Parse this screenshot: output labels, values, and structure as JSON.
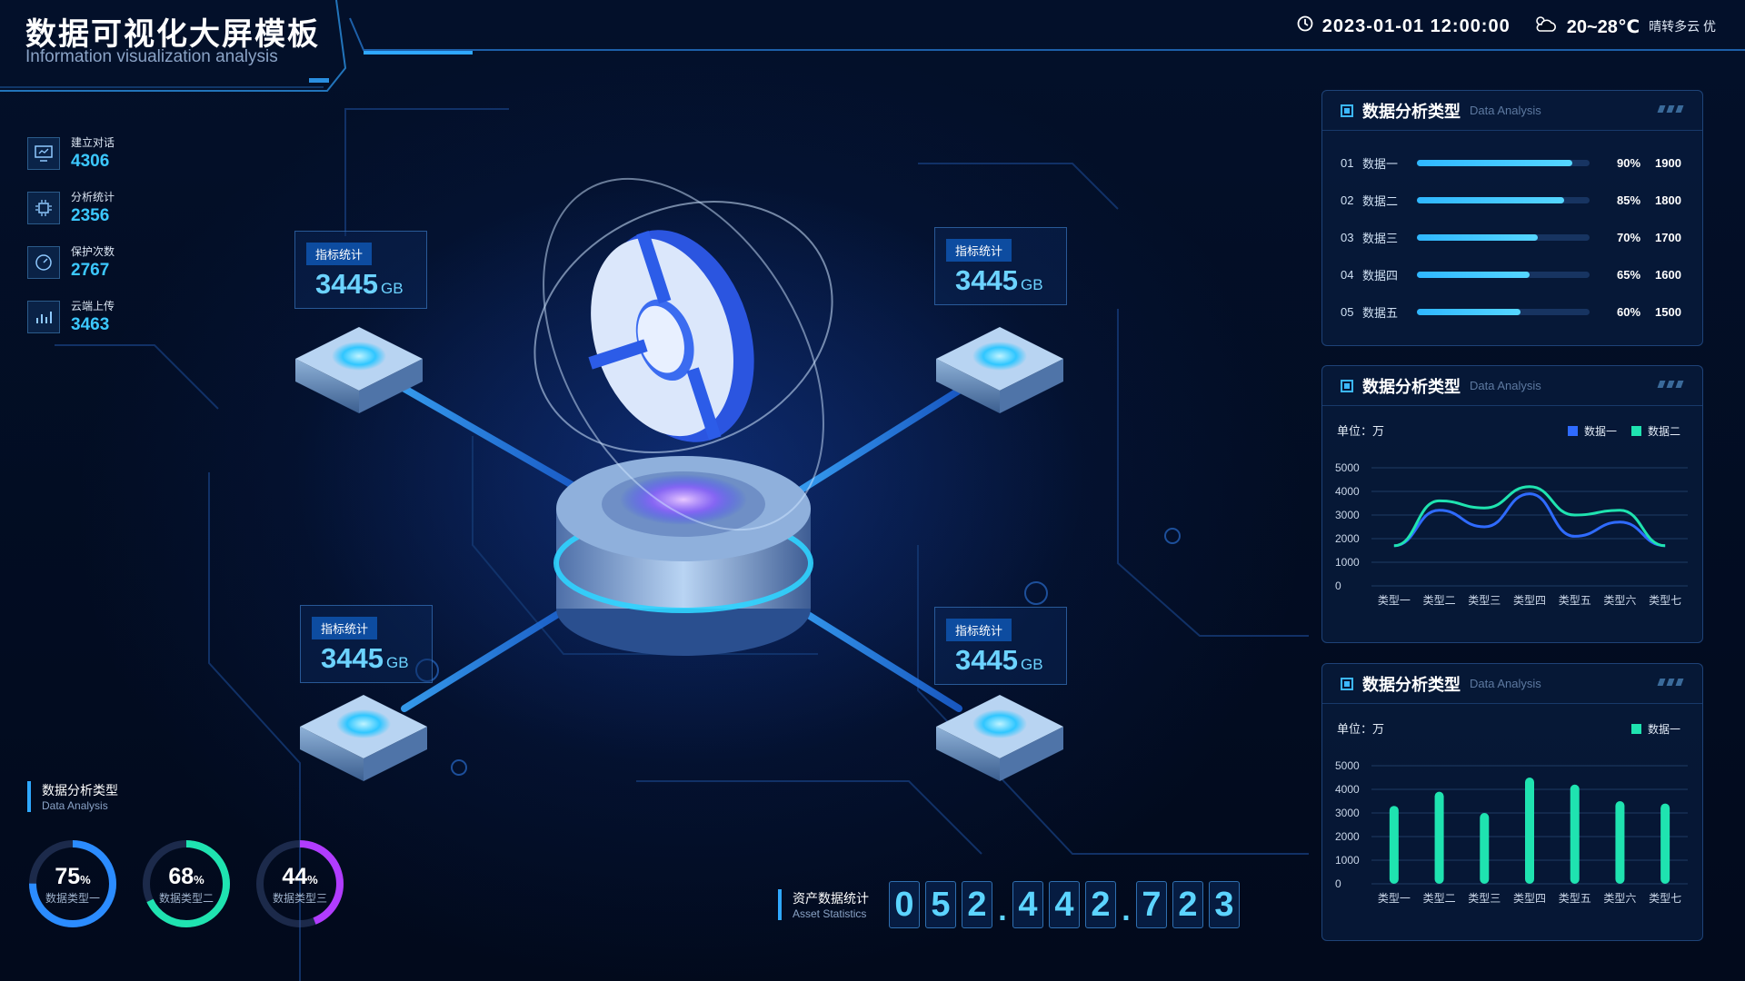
{
  "header": {
    "title": "数据可视化大屏模板",
    "subtitle": "Information visualization analysis",
    "datetime": "2023-01-01  12:00:00",
    "temperature": "20~28℃",
    "weather": "晴转多云  优"
  },
  "stats": [
    {
      "label": "建立对话",
      "value": "4306",
      "icon": "monitor-icon"
    },
    {
      "label": "分析统计",
      "value": "2356",
      "icon": "chip-icon"
    },
    {
      "label": "保护次数",
      "value": "2767",
      "icon": "gauge-icon"
    },
    {
      "label": "云端上传",
      "value": "3463",
      "icon": "chart-bars-icon"
    }
  ],
  "cards": [
    {
      "tag": "指标统计",
      "value": "3445",
      "unit": "GB"
    },
    {
      "tag": "指标统计",
      "value": "3445",
      "unit": "GB"
    },
    {
      "tag": "指标统计",
      "value": "3445",
      "unit": "GB"
    },
    {
      "tag": "指标统计",
      "value": "3445",
      "unit": "GB"
    }
  ],
  "ranking_panel": {
    "title": "数据分析类型",
    "subtitle": "Data Analysis",
    "rows": [
      {
        "idx": "01",
        "name": "数据一",
        "percent": 90,
        "percent_label": "90%",
        "count": "1900"
      },
      {
        "idx": "02",
        "name": "数据二",
        "percent": 85,
        "percent_label": "85%",
        "count": "1800"
      },
      {
        "idx": "03",
        "name": "数据三",
        "percent": 70,
        "percent_label": "70%",
        "count": "1700"
      },
      {
        "idx": "04",
        "name": "数据四",
        "percent": 65,
        "percent_label": "65%",
        "count": "1600"
      },
      {
        "idx": "05",
        "name": "数据五",
        "percent": 60,
        "percent_label": "60%",
        "count": "1500"
      }
    ]
  },
  "line_panel": {
    "title": "数据分析类型",
    "subtitle": "Data Analysis",
    "unit": "单位：万"
  },
  "bar_panel": {
    "title": "数据分析类型",
    "subtitle": "Data Analysis",
    "unit": "单位：万"
  },
  "chart_data": [
    {
      "type": "line",
      "categories": [
        "类型一",
        "类型二",
        "类型三",
        "类型四",
        "类型五",
        "类型六",
        "类型七"
      ],
      "ylim": [
        0,
        5000
      ],
      "yticks": [
        "5000",
        "4000",
        "3000",
        "2000",
        "1000",
        "0"
      ],
      "series": [
        {
          "name": "数据一",
          "color": "#2f6bff",
          "values": [
            1700,
            3200,
            2500,
            3900,
            2100,
            2700,
            1700
          ]
        },
        {
          "name": "数据二",
          "color": "#1fe3b0",
          "values": [
            1700,
            3600,
            3300,
            4200,
            3000,
            3200,
            1700
          ]
        }
      ],
      "legend": "top-right"
    },
    {
      "type": "bar",
      "categories": [
        "类型一",
        "类型二",
        "类型三",
        "类型四",
        "类型五",
        "类型六",
        "类型七"
      ],
      "ylim": [
        0,
        5000
      ],
      "yticks": [
        "5000",
        "4000",
        "3000",
        "2000",
        "1000",
        "0"
      ],
      "series": [
        {
          "name": "数据一",
          "color": "#1fe3b0",
          "values": [
            3300,
            3900,
            3000,
            4500,
            4200,
            3500,
            3400
          ]
        }
      ],
      "legend": "top-right"
    }
  ],
  "rings_section": {
    "title": "数据分析类型",
    "subtitle": "Data Analysis"
  },
  "rings": [
    {
      "percent": 75,
      "num": "75",
      "suffix": "%",
      "label": "数据类型一",
      "color": "#2b8cff"
    },
    {
      "percent": 68,
      "num": "68",
      "suffix": "%",
      "label": "数据类型二",
      "color": "#1fe3b0"
    },
    {
      "percent": 44,
      "num": "44",
      "suffix": "%",
      "label": "数据类型三",
      "color": "#b13cff"
    }
  ],
  "asset": {
    "title": "资产数据统计",
    "subtitle": "Asset Statistics",
    "digits": [
      "0",
      "5",
      "2",
      ".",
      "4",
      "4",
      "2",
      ".",
      "7",
      "2",
      "3"
    ]
  }
}
